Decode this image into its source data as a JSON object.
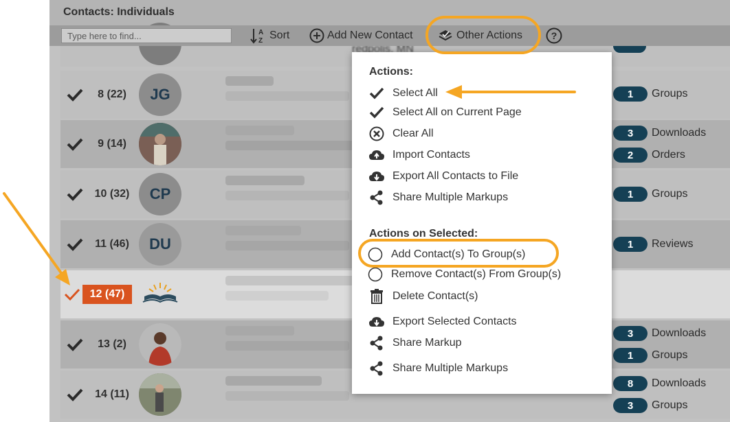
{
  "panel": {
    "title": "Contacts: Individuals"
  },
  "toolbar": {
    "search_placeholder": "Type here to find...",
    "sort_label": "Sort",
    "add_label": "Add New Contact",
    "other_actions_label": "Other Actions",
    "help_icon": "help-icon"
  },
  "rows": [
    {
      "num": "8 (22)",
      "avatar_initials": "JG"
    },
    {
      "num": "9 (14)",
      "avatar_initials": ""
    },
    {
      "num": "10 (32)",
      "avatar_initials": "CP"
    },
    {
      "num": "11 (46)",
      "avatar_initials": "DU"
    },
    {
      "num": "12 (47)",
      "avatar_initials": ""
    },
    {
      "num": "13 (2)",
      "avatar_initials": ""
    },
    {
      "num": "14 (11)",
      "avatar_initials": ""
    }
  ],
  "badges": [
    {
      "count": "1",
      "label": "Groups"
    },
    {
      "count": "3",
      "label": "Downloads"
    },
    {
      "count": "2",
      "label": "Orders"
    },
    {
      "count": "1",
      "label": "Groups"
    },
    {
      "count": "1",
      "label": "Reviews"
    },
    {
      "count": "3",
      "label": "Downloads"
    },
    {
      "count": "1",
      "label": "Groups"
    },
    {
      "count": "8",
      "label": "Downloads"
    },
    {
      "count": "3",
      "label": "Groups"
    }
  ],
  "partial_row": {
    "location_fragment": "redpolis, MN"
  },
  "menu": {
    "actions_heading": "Actions:",
    "actions": [
      {
        "label": "Select All",
        "icon": "check-icon"
      },
      {
        "label": "Select All on Current Page",
        "icon": "check-icon"
      },
      {
        "label": "Clear All",
        "icon": "clear-icon"
      },
      {
        "label": "Import Contacts",
        "icon": "cloud-upload-icon"
      },
      {
        "label": "Export All Contacts to File",
        "icon": "cloud-download-icon"
      },
      {
        "label": "Share Multiple Markups",
        "icon": "share-icon"
      }
    ],
    "selected_heading": "Actions on Selected:",
    "selected_actions": [
      {
        "label": "Add Contact(s) To Group(s)",
        "icon": "radio-icon"
      },
      {
        "label": "Remove Contact(s) From Group(s)",
        "icon": "radio-icon"
      },
      {
        "label": "Delete Contact(s)",
        "icon": "trash-icon"
      },
      {
        "label": "Export Selected Contacts",
        "icon": "cloud-download-icon"
      },
      {
        "label": "Share Markup",
        "icon": "share-icon"
      },
      {
        "label": "Share Multiple Markups",
        "icon": "share-icon"
      }
    ]
  },
  "colors": {
    "badge": "#154055",
    "highlight": "#f5a623",
    "selected_row": "#d9531e"
  }
}
